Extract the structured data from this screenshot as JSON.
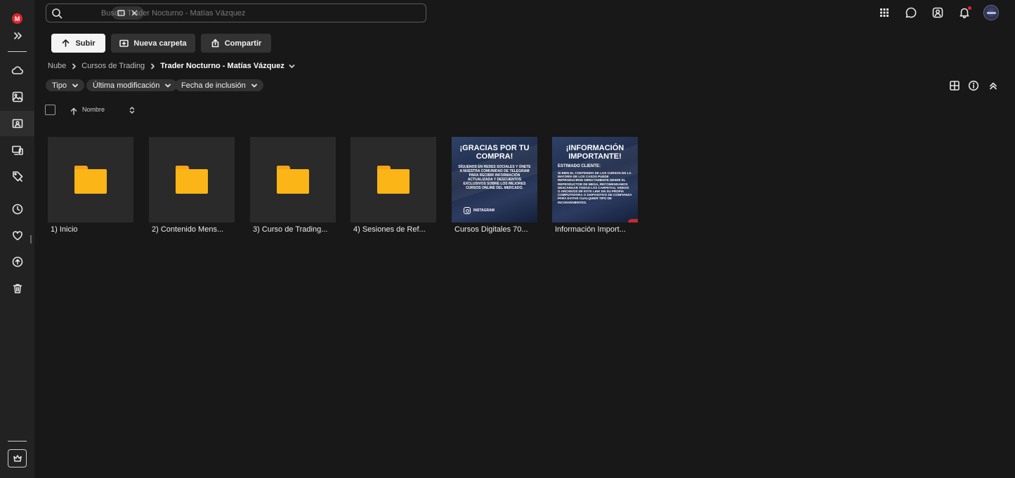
{
  "search": {
    "placeholder": "Buscar Trader Nocturno - Matías Vázquez",
    "chip_icons": [
      "folder-icon",
      "close-icon"
    ]
  },
  "sidebar": {
    "logo": "M",
    "items": [
      {
        "name": "expand",
        "icon": "double-chevron-right-icon"
      },
      {
        "name": "cloud-drive",
        "icon": "cloud-icon"
      },
      {
        "name": "photos",
        "icon": "image-icon"
      },
      {
        "name": "shared",
        "icon": "shared-folder-icon",
        "active": true
      },
      {
        "name": "devices",
        "icon": "devices-icon"
      },
      {
        "name": "contacts-tag",
        "icon": "tag-icon"
      },
      {
        "name": "recents",
        "icon": "clock-icon"
      },
      {
        "name": "favourites",
        "icon": "heart-icon"
      },
      {
        "name": "backups",
        "icon": "sync-icon"
      },
      {
        "name": "trash",
        "icon": "trash-icon"
      }
    ],
    "pro_icon": "crown-icon"
  },
  "topbar": {
    "icons": [
      "apps-grid-icon",
      "chat-icon",
      "contacts-icon",
      "bell-icon"
    ],
    "notification_dot": "#e0252f"
  },
  "toolbar": {
    "upload_label": "Subir",
    "new_folder_label": "Nueva carpeta",
    "share_label": "Compartir"
  },
  "breadcrumb": {
    "items": [
      "Nube",
      "Cursos de Trading"
    ],
    "current": "Trader Nocturno - Matías Vázquez"
  },
  "filters": [
    {
      "label": "Tipo"
    },
    {
      "label": "Última modificación"
    },
    {
      "label": "Fecha de inclusión"
    }
  ],
  "view_icons": [
    "grid-view-icon",
    "info-icon",
    "collapse-icon"
  ],
  "list_header": {
    "name_label": "Nombre"
  },
  "items": [
    {
      "type": "folder",
      "label": "1) Inicio"
    },
    {
      "type": "folder",
      "label": "2) Contenido Mens..."
    },
    {
      "type": "folder",
      "label": "3) Curso de Trading..."
    },
    {
      "type": "folder",
      "label": "4) Sesiones de Ref..."
    },
    {
      "type": "image",
      "label": "Cursos Digitales 70...",
      "thumb_title": "¡GRACIAS POR TU COMPRA!",
      "thumb_body": "SÍGUENOS EN REDES SOCIALES Y ÚNETE A NUESTRA COMUNIDAD DE TELEGRAM PARA RECIBIR INFORMACIÓN ACTUALIZADA Y DESCUENTOS EXCLUSIVOS SOBRE LOS MEJORES CURSOS ONLINE DEL MERCADO.",
      "thumb_social": "INSTAGRAM"
    },
    {
      "type": "image",
      "label": "Información Import...",
      "thumb_title": "¡INFORMACIÓN IMPORTANTE!",
      "thumb_subtitle": "ESTIMADO CLIENTE:",
      "thumb_body": "SI BIEN EL CONTENIDO DE LOS CURSOS EN LA MAYORÍA DE LOS CASOS PUEDE REPRODUCIRSE DIRECTAMENTE DESDE EL REPRODUCTOR DE MEGA, RECOMENDAMOS DESCARGAR TODAS LAS CARPETAS, VIDEOS O ARCHIVOS DE ESTE LINK EN SU PROPIA COMPUTADORA O DISPOSITIVO DE CONFIANZA PARA EVITAR CUALQUIER TIPO DE INCONVENIENTES."
    }
  ],
  "colors": {
    "background": "#181818",
    "sidebar": "#222222",
    "tile": "#2a2a2a",
    "folder": "#fbb516",
    "accent": "#e0252f"
  }
}
